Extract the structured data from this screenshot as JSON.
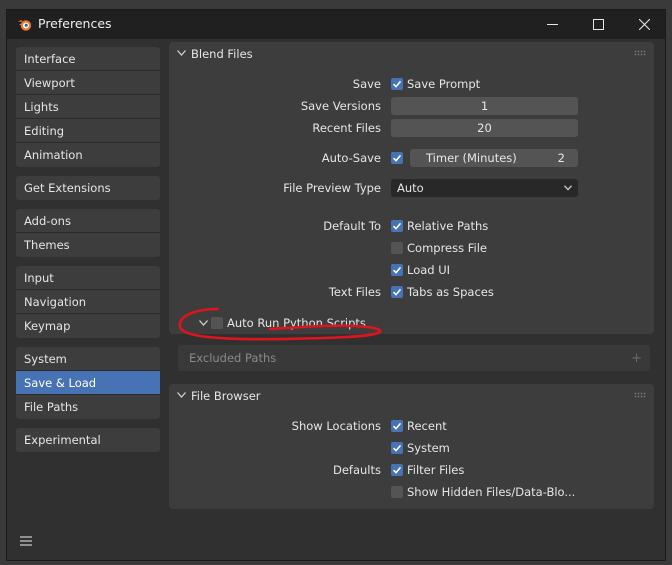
{
  "window": {
    "title": "Preferences"
  },
  "sidebar": {
    "groups": [
      [
        {
          "label": "Interface"
        },
        {
          "label": "Viewport"
        },
        {
          "label": "Lights"
        },
        {
          "label": "Editing"
        },
        {
          "label": "Animation"
        }
      ],
      [
        {
          "label": "Get Extensions"
        }
      ],
      [
        {
          "label": "Add-ons"
        },
        {
          "label": "Themes"
        }
      ],
      [
        {
          "label": "Input"
        },
        {
          "label": "Navigation"
        },
        {
          "label": "Keymap"
        }
      ],
      [
        {
          "label": "System"
        },
        {
          "label": "Save & Load",
          "active": true
        },
        {
          "label": "File Paths"
        }
      ],
      [
        {
          "label": "Experimental"
        }
      ]
    ]
  },
  "blend_files": {
    "title": "Blend Files",
    "save_label": "Save",
    "save_prompt": {
      "label": "Save Prompt",
      "checked": true
    },
    "save_versions": {
      "label": "Save Versions",
      "value": "1"
    },
    "recent_files": {
      "label": "Recent Files",
      "value": "20"
    },
    "auto_save": {
      "label": "Auto-Save",
      "checked": true,
      "timer_label": "Timer (Minutes)",
      "timer_value": "2"
    },
    "file_preview": {
      "label": "File Preview Type",
      "value": "Auto"
    },
    "default_to_label": "Default To",
    "relative_paths": {
      "label": "Relative Paths",
      "checked": true
    },
    "compress_file": {
      "label": "Compress File",
      "checked": false
    },
    "load_ui": {
      "label": "Load UI",
      "checked": true
    },
    "text_files_label": "Text Files",
    "tabs_as_spaces": {
      "label": "Tabs as Spaces",
      "checked": true
    },
    "auto_run": {
      "label": "Auto Run Python Scripts",
      "checked": false
    },
    "excluded_paths": {
      "label": "Excluded Paths"
    }
  },
  "file_browser": {
    "title": "File Browser",
    "show_locations_label": "Show Locations",
    "recent": {
      "label": "Recent",
      "checked": true
    },
    "system": {
      "label": "System",
      "checked": true
    },
    "defaults_label": "Defaults",
    "filter_files": {
      "label": "Filter Files",
      "checked": true
    },
    "show_hidden": {
      "label": "Show Hidden Files/Data-Blo...",
      "checked": false
    }
  },
  "colors": {
    "accent": "#4772b3",
    "annotation": "#e0141e"
  }
}
